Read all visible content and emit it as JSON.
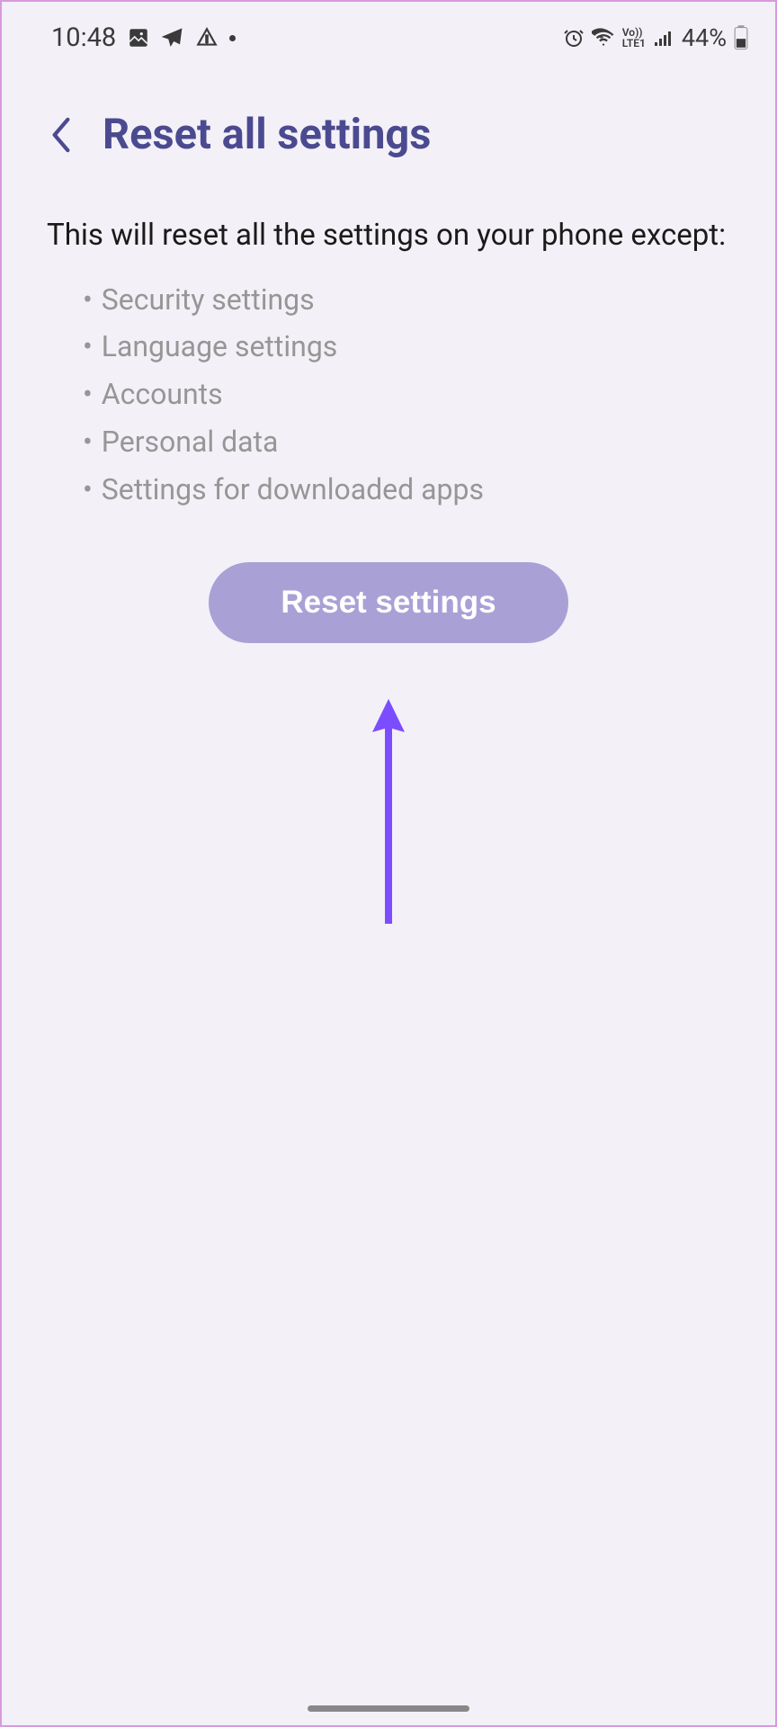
{
  "status_bar": {
    "time": "10:48",
    "battery_percent": "44%"
  },
  "header": {
    "title": "Reset all settings"
  },
  "content": {
    "description": "This will reset all the settings on your phone except:",
    "exceptions": [
      "Security settings",
      "Language settings",
      "Accounts",
      "Personal data",
      "Settings for downloaded apps"
    ],
    "button_label": "Reset settings"
  }
}
